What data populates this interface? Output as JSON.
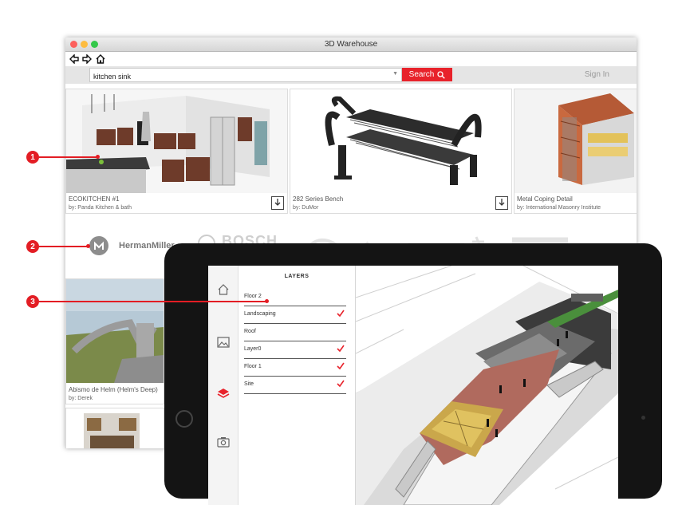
{
  "window": {
    "title": "3D Warehouse"
  },
  "nav": {
    "back_icon": "back-arrow-icon",
    "forward_icon": "forward-arrow-icon",
    "home_icon": "home-icon"
  },
  "search": {
    "value": "kitchen sink",
    "button_label": "Search",
    "sign_in_label": "Sign In"
  },
  "results": [
    {
      "title": "ECOKITCHEN #1",
      "by": "by: Panda Kitchen & bath"
    },
    {
      "title": "282 Series Bench",
      "by": "by: DuMor"
    },
    {
      "title": "Metal Coping Detail",
      "by": "by: International Masonry Institute"
    }
  ],
  "brands": [
    "HermanMiller",
    "BOSCH"
  ],
  "results_row2": [
    {
      "title": "Abismo de Helm (Helm's Deep)",
      "by": "by: Derek"
    }
  ],
  "callouts": [
    "1",
    "2",
    "3"
  ],
  "tablet": {
    "layers_title": "LAYERS",
    "layers": [
      {
        "name": "Floor 2",
        "checked": false
      },
      {
        "name": "Landscaping",
        "checked": true
      },
      {
        "name": "Roof",
        "checked": false
      },
      {
        "name": "Layer0",
        "checked": true
      },
      {
        "name": "Floor 1",
        "checked": true
      },
      {
        "name": "Site",
        "checked": true
      }
    ],
    "rail_icons": [
      "home-icon",
      "image-icon",
      "layers-icon",
      "camera-icon"
    ]
  },
  "colors": {
    "accent": "#e8222b",
    "callout": "#e31d24"
  }
}
